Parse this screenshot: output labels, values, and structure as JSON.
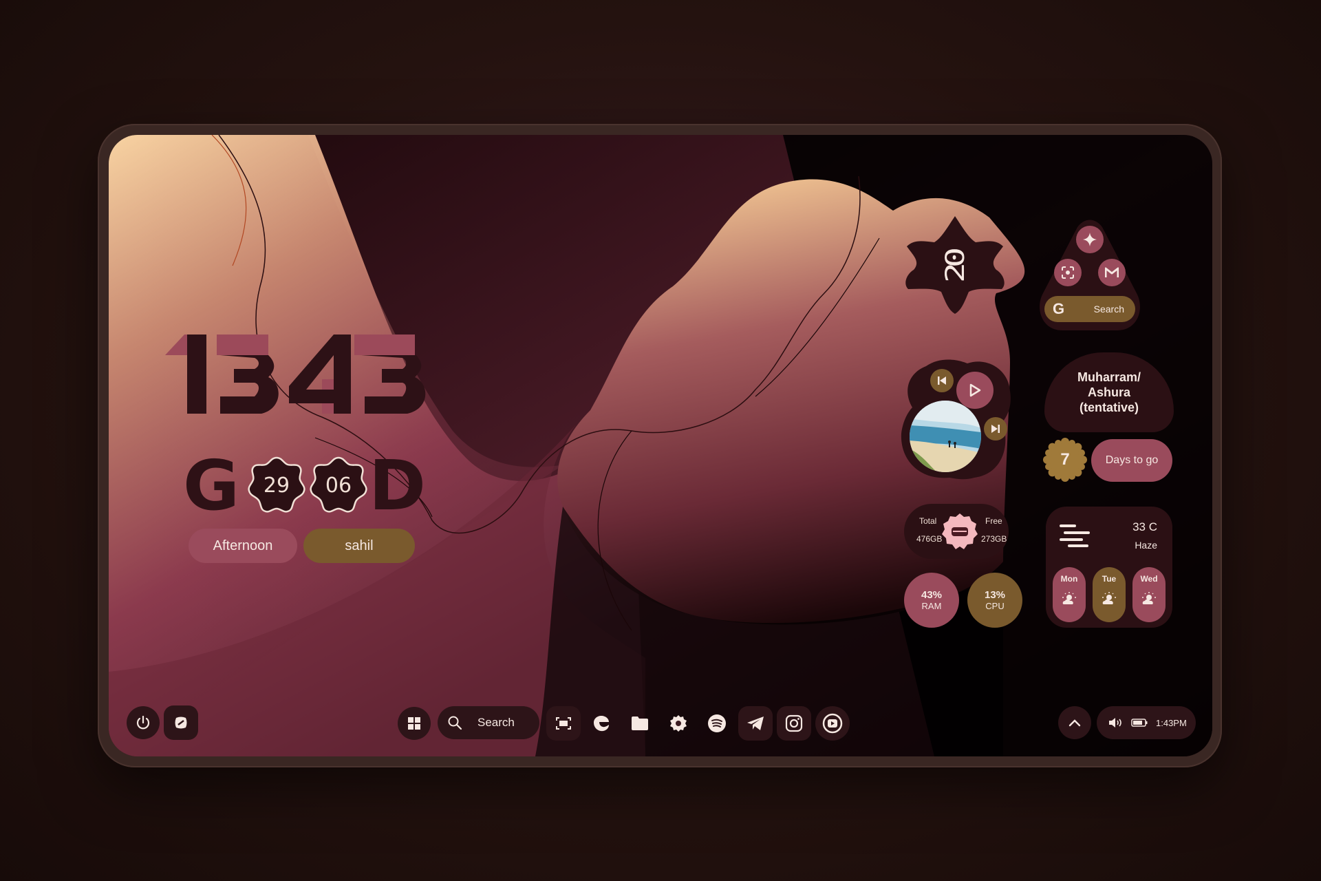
{
  "clock": {
    "hours": "13",
    "minutes": "43"
  },
  "date_widget": {
    "letter_start": "G",
    "day": "29",
    "month": "06",
    "letter_end": "D",
    "period": "Afternoon",
    "user": "sahil"
  },
  "top_badge": {
    "number": "20"
  },
  "quick_panel": {
    "search_label": "Search"
  },
  "event": {
    "title_line1": "Muharram/",
    "title_line2": "Ashura",
    "title_line3": "(tentative)",
    "days": "7",
    "days_label": "Days to go"
  },
  "storage": {
    "total_label": "Total",
    "total_value": "476GB",
    "free_label": "Free",
    "free_value": "273GB"
  },
  "system": {
    "ram_value": "43%",
    "ram_label": "RAM",
    "cpu_value": "13%",
    "cpu_label": "CPU"
  },
  "weather": {
    "temp": "33 C",
    "condition": "Haze",
    "days": [
      "Mon",
      "Tue",
      "Wed"
    ]
  },
  "taskbar": {
    "search_label": "Search",
    "time": "1:43PM",
    "apps": [
      "snipping-tool",
      "edge",
      "file-explorer",
      "settings",
      "spotify",
      "telegram",
      "instagram",
      "youtube"
    ]
  },
  "colors": {
    "rose": "#9c4a5a",
    "gold": "#7a5a2d",
    "dark": "#2b1014",
    "peach": "#f6d2a2"
  }
}
